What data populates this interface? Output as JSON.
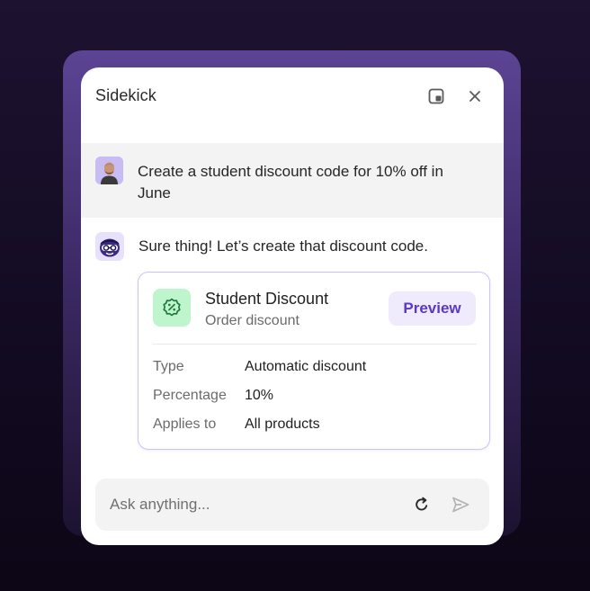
{
  "app": {
    "title": "Sidekick",
    "icons": {
      "popout": "popout-icon",
      "close": "close-icon"
    }
  },
  "colors": {
    "accent": "#5a37c9",
    "accent_soft": "#efebfd",
    "card_border": "#cdc4f3",
    "discount_icon_bg": "#bff5cc",
    "discount_icon_fg": "#1e7a3a"
  },
  "messages": {
    "user": {
      "avatar": "user-avatar",
      "text": "Create a student discount code for 10% off in June"
    },
    "assistant": {
      "avatar": "sidekick-avatar",
      "text": "Sure thing! Let’s create that discount code."
    }
  },
  "discount_card": {
    "icon": "discount-percent-icon",
    "title": "Student Discount",
    "subtitle": "Order discount",
    "preview_label": "Preview",
    "details": [
      {
        "label": "Type",
        "value": "Automatic discount"
      },
      {
        "label": "Percentage",
        "value": "10%"
      },
      {
        "label": "Applies to",
        "value": "All products"
      }
    ]
  },
  "composer": {
    "placeholder": "Ask anything...",
    "value": "",
    "icons": {
      "refresh": "refresh-icon",
      "send": "send-icon"
    }
  }
}
